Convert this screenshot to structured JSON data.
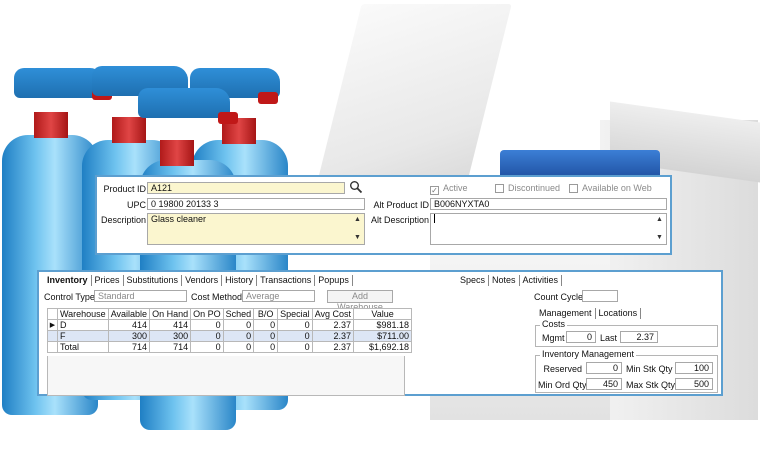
{
  "header": {
    "product_id_label": "Product ID",
    "product_id_value": "A121",
    "upc_label": "UPC",
    "upc_value": "0 19800 20133 3",
    "description_label": "Description",
    "description_value": "Glass cleaner",
    "active_label": "Active",
    "active_checked": true,
    "discontinued_label": "Discontinued",
    "available_on_web_label": "Available on Web",
    "alt_product_id_label": "Alt Product ID",
    "alt_product_id_value": "B006NYXTA0",
    "alt_description_label": "Alt Description",
    "alt_description_value": ""
  },
  "tabs": {
    "left": [
      "Inventory",
      "Prices",
      "Substitutions",
      "Vendors",
      "History",
      "Transactions",
      "Popups"
    ],
    "right": [
      "Specs",
      "Notes",
      "Activities"
    ]
  },
  "inventory": {
    "control_type_label": "Control Type",
    "control_type_value": "Standard",
    "cost_method_label": "Cost Method",
    "cost_method_value": "Average",
    "add_warehouse_label": "Add Warehouse",
    "columns": [
      "Warehouse",
      "Available",
      "On Hand",
      "On PO",
      "Sched",
      "B/O",
      "Special",
      "Avg Cost",
      "Value"
    ],
    "rows": [
      [
        "D",
        "414",
        "414",
        "0",
        "0",
        "0",
        "0",
        "2.37",
        "$981.18"
      ],
      [
        "F",
        "300",
        "300",
        "0",
        "0",
        "0",
        "0",
        "2.37",
        "$711.00"
      ],
      [
        "Total",
        "714",
        "714",
        "0",
        "0",
        "0",
        "0",
        "2.37",
        "$1,692.18"
      ]
    ]
  },
  "side": {
    "count_cycle_label": "Count Cycle",
    "count_cycle_value": "",
    "subtabs": [
      "Management",
      "Locations"
    ],
    "costs_title": "Costs",
    "mgmt_label": "Mgmt",
    "mgmt_value": "0",
    "last_label": "Last",
    "last_value": "2.37",
    "inv_mgmt_title": "Inventory Management",
    "reserved_label": "Reserved",
    "reserved_value": "0",
    "min_stk_label": "Min Stk Qty",
    "min_stk_value": "100",
    "min_ord_label": "Min Ord Qty",
    "min_ord_value": "450",
    "max_stk_label": "Max Stk Qty",
    "max_stk_value": "500"
  },
  "colors": {
    "panel_border": "#5c9fd0",
    "highlight_field": "#fbf6cf",
    "selected_row": "#dde6f5"
  }
}
